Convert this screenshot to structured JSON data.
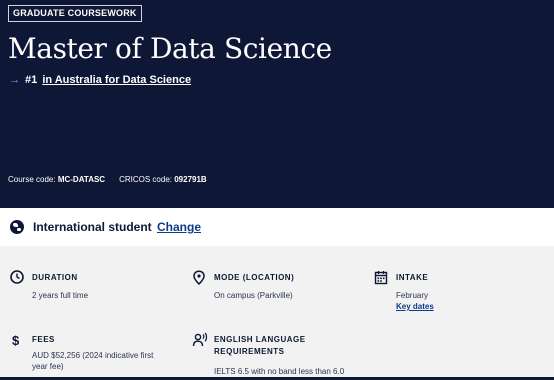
{
  "hero": {
    "badge": "GRADUATE COURSEWORK",
    "title": "Master of Data Science",
    "rank_prefix": "#1",
    "rank_link": "in Australia for Data Science",
    "course_code_label": "Course code:",
    "course_code": "MC-DATASC",
    "cricos_label": "CRICOS code:",
    "cricos_code": "092791B"
  },
  "student": {
    "label": "International student",
    "change": "Change"
  },
  "facts": {
    "duration": {
      "heading": "DURATION",
      "value": "2 years full time"
    },
    "mode": {
      "heading": "MODE (LOCATION)",
      "value": "On campus (Parkville)"
    },
    "intake": {
      "heading": "INTAKE",
      "value": "February",
      "link": "Key dates"
    },
    "fees": {
      "heading": "FEES",
      "value_line1": "AUD $52,256 (2024 indicative first",
      "value_line2": "year fee)"
    },
    "english": {
      "heading_line1": "ENGLISH LANGUAGE",
      "heading_line2": "REQUIREMENTS",
      "value": "IELTS 6.5 with no band less than 6.0"
    }
  },
  "colors": {
    "hero_bg": "#0f1736",
    "accent": "#6ab0ff",
    "link": "#0d3b87",
    "page_bg": "#f2f2f2"
  }
}
